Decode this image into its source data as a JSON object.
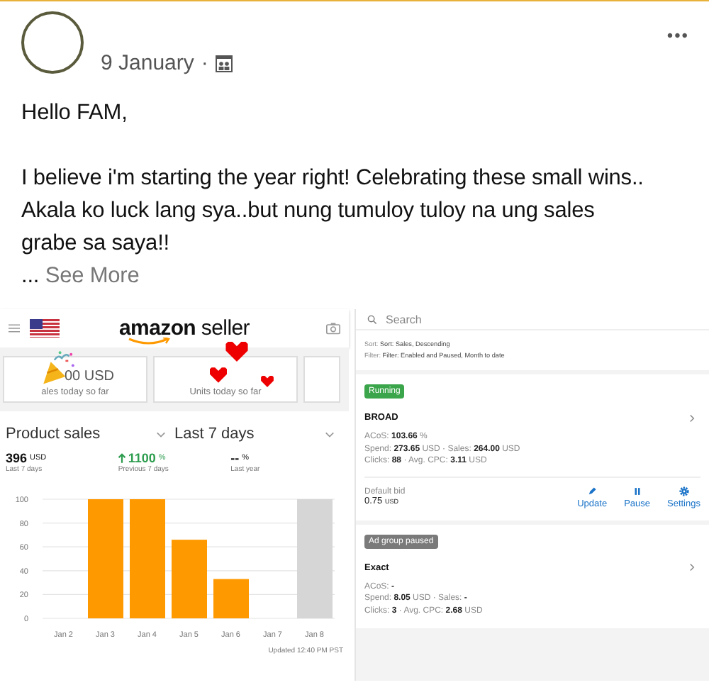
{
  "post": {
    "date": "9 January",
    "separator": "·",
    "more": "•••",
    "lines": [
      "Hello FAM,",
      "I believe i'm starting the year right! Celebrating these small wins..",
      "Akala ko luck lang sya..but nung tumuloy tuloy na ung sales grabe sa saya!!"
    ],
    "ellipsis": "...",
    "see_more": "See More"
  },
  "seller_app": {
    "brand": "amazon",
    "brand_suffix": "seller",
    "cards": [
      {
        "value": "00 USD",
        "label": "ales today so far"
      },
      {
        "label": "Units today so far"
      }
    ],
    "metric": "Product sales",
    "period": "Last 7 days",
    "stats": [
      {
        "kind": "plain",
        "value": "396",
        "unit": "USD",
        "label": "Last 7 days"
      },
      {
        "kind": "up",
        "value": "1100",
        "unit": "%",
        "label": "Previous 7 days"
      },
      {
        "kind": "plain",
        "value": "--",
        "unit": "%",
        "label": "Last year"
      }
    ],
    "chart_data": {
      "type": "bar",
      "grid": true,
      "categories": [
        "Jan 2",
        "Jan 3",
        "Jan 4",
        "Jan 5",
        "Jan 6",
        "Jan 7",
        "Jan 8"
      ],
      "ylim": [
        0,
        100
      ],
      "yticks": [
        0,
        20,
        40,
        60,
        80,
        100
      ],
      "series": [
        {
          "color": "#ff9900",
          "values": [
            0,
            100,
            100,
            66,
            33,
            0,
            null
          ]
        },
        {
          "color": "#d6d6d6",
          "values": [
            null,
            null,
            null,
            null,
            null,
            null,
            100
          ]
        }
      ]
    },
    "updated": "Updated 12:40 PM PST"
  },
  "ads_app": {
    "search": {
      "placeholder": "Search"
    },
    "sort_label": "Sort:",
    "sort_value": "Sort: Sales, Descending",
    "filter_label": "Filter:",
    "filter_value": "Filter: Enabled and Paused, Month to date",
    "ad_groups": [
      {
        "status": "Running",
        "paused": false,
        "name": "BROAD",
        "lines": [
          "ACoS: **103.66** %",
          "Spend: **273.65** USD · Sales: **264.00** USD",
          "Clicks: **88** · Avg. CPC: **3.11** USD"
        ],
        "bid": {
          "label": "Default bid",
          "value": "0.75",
          "unit": "USD"
        },
        "actions": [
          {
            "kind": "edit",
            "label": "Update"
          },
          {
            "kind": "pause",
            "label": "Pause"
          },
          {
            "kind": "settings",
            "label": "Settings"
          }
        ]
      },
      {
        "status": "Ad group paused",
        "paused": true,
        "name": "Exact",
        "lines": [
          "ACoS: **-**",
          "Spend: **8.05** USD · Sales: **-**",
          "Clicks: **3** · Avg. CPC: **2.68** USD"
        ]
      }
    ]
  }
}
